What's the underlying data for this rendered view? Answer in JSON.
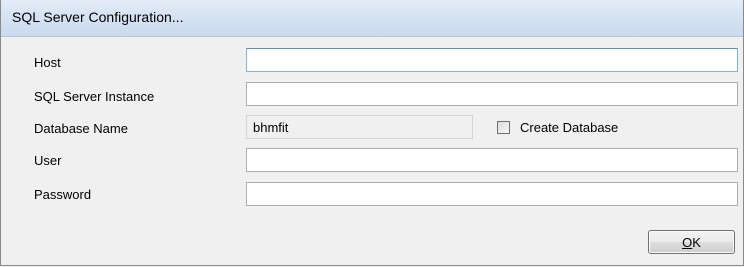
{
  "window": {
    "title": "SQL Server Configuration..."
  },
  "form": {
    "host": {
      "label": "Host",
      "value": ""
    },
    "instance": {
      "label": "SQL Server Instance",
      "value": ""
    },
    "database": {
      "label": "Database Name",
      "value": "bhmfit"
    },
    "create_database": {
      "label": "Create Database",
      "checked": false
    },
    "user": {
      "label": "User",
      "value": ""
    },
    "password": {
      "label": "Password",
      "value": ""
    }
  },
  "buttons": {
    "ok_mnemonic": "O",
    "ok_rest": "K"
  },
  "colors": {
    "titlebar": "#d4e1f2",
    "window_bg": "#f0f0f0",
    "focus_border": "#7eb4ea"
  }
}
